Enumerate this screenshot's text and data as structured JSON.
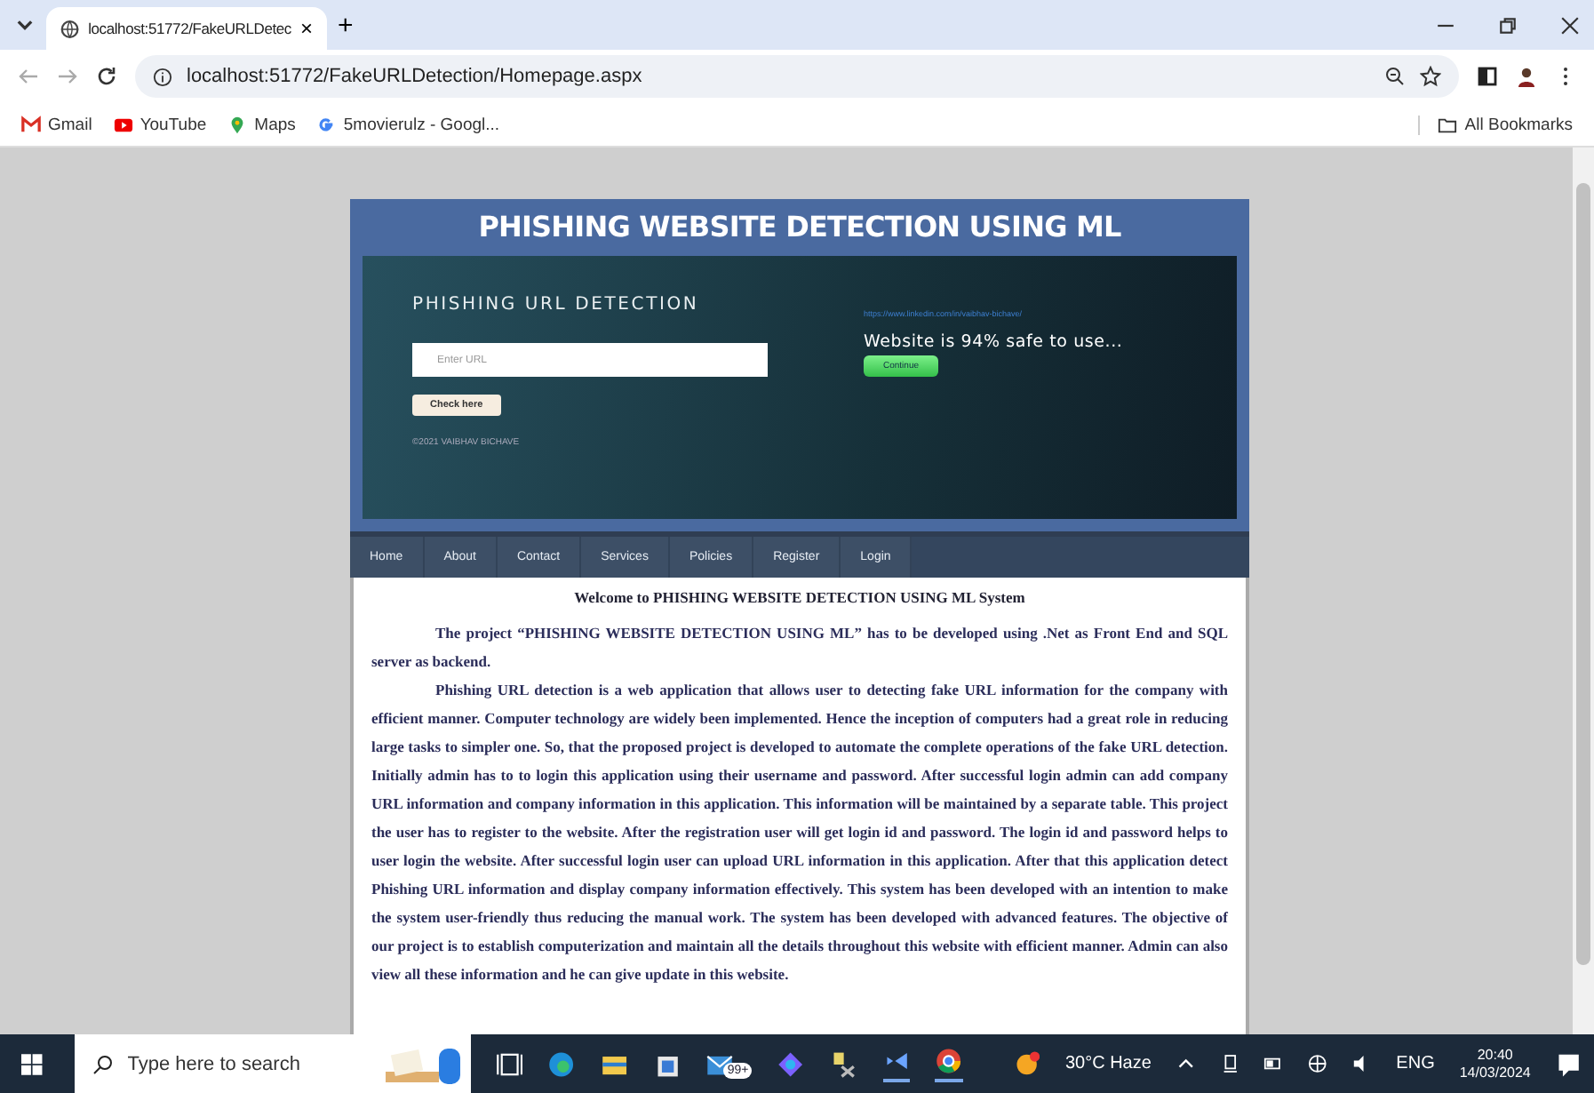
{
  "browser": {
    "tab_title": "localhost:51772/FakeURLDetec",
    "tab_close": "×",
    "new_tab": "+",
    "address": "localhost:51772/FakeURLDetection/Homepage.aspx",
    "bookmarks": [
      "Gmail",
      "YouTube",
      "Maps",
      "5movierulz - Googl..."
    ],
    "all_bookmarks": "All Bookmarks"
  },
  "page": {
    "title": "PHISHING WEBSITE DETECTION USING ML",
    "banner": {
      "heading": "PHISHING URL DETECTION",
      "url_field": {
        "placeholder": "Enter URL"
      },
      "check_button": "Check here",
      "copyright": "©2021 VAIBHAV BICHAVE",
      "result_link": "https://www.linkedin.com/in/vaibhav-bichave/",
      "result": "Website is 94% safe to use...",
      "continue_button": "Continue"
    },
    "nav": [
      {
        "label": "Home",
        "selected": false
      },
      {
        "label": "About",
        "selected": false
      },
      {
        "label": "Contact",
        "selected": false
      },
      {
        "label": "Services",
        "selected": false
      },
      {
        "label": "Policies",
        "selected": false
      },
      {
        "label": "Register",
        "selected": false
      },
      {
        "label": "Login",
        "selected": false
      }
    ],
    "welcome": "Welcome to PHISHING WEBSITE DETECTION USING ML System",
    "paragraphs": [
      "The project “PHISHING WEBSITE DETECTION USING ML” has to be developed using .Net as Front End and SQL server as backend.",
      "Phishing URL detection is a web application that allows user to detecting fake URL information for the company with efficient manner. Computer technology are widely been implemented. Hence the inception of computers had a great role in reducing large tasks to simpler one. So, that the proposed project is developed to automate the complete operations of the fake URL detection. Initially admin has to to login this application using their username and password. After successful login admin can add company URL information and company information in this application. This information will be maintained by a separate table. This project the user has to register to the website. After the registration user will get login id and password. The login id and password helps to user login the website. After successful login user can upload URL information in this application. After that this application detect Phishing URL information and display company information effectively. This system has been developed with an intention to make the system user-friendly thus reducing the manual work. The system has been developed with advanced features. The objective of our project is to establish computerization and maintain all the details throughout this website with efficient manner. Admin can also view all these information and he can give update in this website."
    ]
  },
  "taskbar": {
    "search": {
      "placeholder": "Type here to search"
    },
    "mail_badge": "99+",
    "weather": "30°C  Haze",
    "language": "ENG",
    "time": "20:40",
    "date": "14/03/2024"
  }
}
